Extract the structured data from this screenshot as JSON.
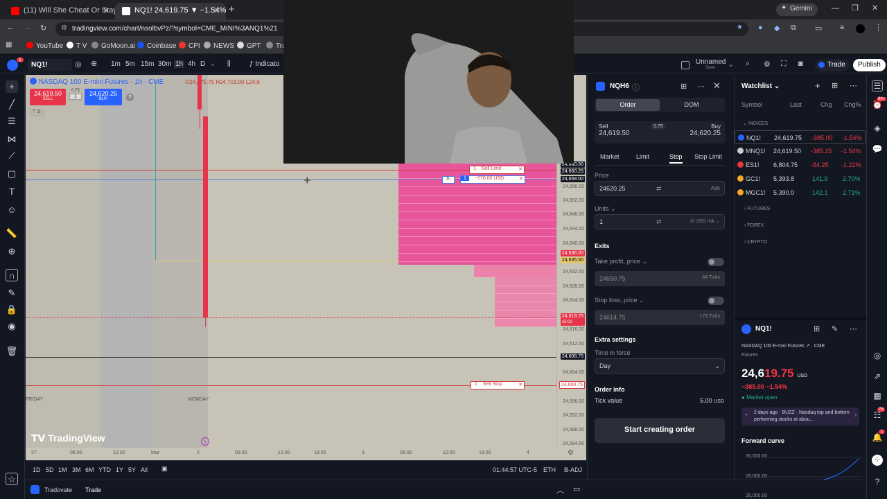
{
  "browser": {
    "tabs": [
      {
        "title": "(11) Will She Cheat Or Stay",
        "active": false
      },
      {
        "title": "NQ1! 24,619.75 ▼ −1.54% Unn",
        "active": true
      }
    ],
    "url": "tradingview.com/chart/nsolbvPz/?symbol=CME_MINI%3ANQ1%21",
    "gemini_label": "Gemini",
    "bookmarks": [
      "YouTube",
      "T V",
      "GoMoon.ai",
      "Coinbase",
      "CPI",
      "NEWS",
      "GPT",
      "Tra"
    ]
  },
  "toolbar": {
    "symbol": "NQ1!",
    "intervals": [
      "1m",
      "5m",
      "15m",
      "30m",
      "1h",
      "4h",
      "D"
    ],
    "active_interval": "1h",
    "indicators_label": "Indicato",
    "layout_name": "Unnamed",
    "layout_sub": "Save",
    "trade_label": "Trade",
    "publish_label": "Publish"
  },
  "chart": {
    "title": "NASDAQ 100 E-mini Futures · 1h · CME",
    "ohlc": "O24,675.75  H24,703.00  L24,6",
    "sell_price": "24,619.50",
    "sell_label": "SELL",
    "spread": "0.75",
    "qty": "1",
    "buy_price": "24,620.25",
    "buy_label": "BUY",
    "indicator_count": "2",
    "sell_limit_label": "Sell Limit",
    "sell_limit_qty": "1",
    "position_qty": "1",
    "position_side": "1L",
    "position_pnl": "−770.00 USD",
    "sell_stop_label": "Sell Stop",
    "sell_stop_qty": "1",
    "day_labels": [
      "FRIDAY",
      "MONDAY"
    ],
    "watermark": "TradingView",
    "price_labels": [
      "24,656.00",
      "24,652.00",
      "24,648.00",
      "24,644.00",
      "24,640.00",
      "24,632.00",
      "24,628.00",
      "24,624.00",
      "24,616.00",
      "24,612.00",
      "24,604.00",
      "24,596.00",
      "24,592.00",
      "24,588.00",
      "24,584.00"
    ],
    "tag_limit_1": "24,660.50",
    "tag_limit_2": "24,660.25",
    "tag_pos": "24,658.00",
    "tag_636": "24,636.00",
    "tag_635": "24,635.50",
    "tag_last": "24,619.75",
    "tag_last_time": "15:02",
    "tag_608": "24,608.75",
    "tag_stop": "24,600.75",
    "time_labels": [
      "27",
      "06:00",
      "12:00",
      "Mar",
      "2",
      "06:00",
      "12:00",
      "18:00",
      "3",
      "06:00",
      "12:00",
      "18:00",
      "4"
    ],
    "ranges": [
      "1D",
      "5D",
      "1M",
      "3M",
      "6M",
      "YTD",
      "1Y",
      "5Y",
      "All"
    ],
    "clock": "01:44:57 UTC-5",
    "session": "ETH",
    "adj": "B-ADJ"
  },
  "status": {
    "broker": "Tradovate",
    "trade_tab": "Trade"
  },
  "order": {
    "symbol": "NQH6",
    "tabs": [
      "Order",
      "DOM"
    ],
    "sell_label": "Sell",
    "sell_price": "24,619.50",
    "spread": "0.75",
    "buy_label": "Buy",
    "buy_price": "24,620.25",
    "types": [
      "Market",
      "Limit",
      "Stop",
      "Stop Limit"
    ],
    "active_type": "Stop",
    "price_label": "Price",
    "price_value": "24620.25",
    "price_side": "Ask",
    "units_label": "Units",
    "units_value": "1",
    "units_mode": "USD risk",
    "exits_label": "Exits",
    "tp_label": "Take profit, price",
    "tp_value": "24650.75",
    "tp_ticks": "64 Ticks",
    "sl_label": "Stop loss, price",
    "sl_value": "24614.75",
    "sl_ticks": "173 Ticks",
    "extra_label": "Extra settings",
    "tif_label": "Time in force",
    "tif_value": "Day",
    "info_label": "Order info",
    "tick_label": "Tick value",
    "tick_value": "5.00",
    "tick_unit": "USD",
    "submit_label": "Start creating order"
  },
  "watchlist": {
    "title": "Watchlist",
    "columns": [
      "Symbol",
      "Last",
      "Chg",
      "Chg%"
    ],
    "group": "INDICES",
    "rows": [
      {
        "symbol": "NQ1!",
        "last": "24,619.75",
        "chg": "-385.00",
        "chgp": "-1.54%",
        "dir": "down",
        "color": "#2962ff"
      },
      {
        "symbol": "MNQ1!",
        "last": "24,619.50",
        "chg": "-385.25",
        "chgp": "-1.54%",
        "dir": "down",
        "color": "#cccccc"
      },
      {
        "symbol": "ES1!",
        "last": "6,804.75",
        "chg": "-84.25",
        "chgp": "-1.22%",
        "dir": "down",
        "color": "#e53935"
      },
      {
        "symbol": "GC1!",
        "last": "5,393.8",
        "chg": "141.9",
        "chgp": "2.70%",
        "dir": "up",
        "color": "#f9a825"
      },
      {
        "symbol": "MGC1!",
        "last": "5,390.0",
        "chg": "142.1",
        "chgp": "2.71%",
        "dir": "up",
        "color": "#f9a825"
      }
    ],
    "collapsed": [
      "FUTURES",
      "FOREX",
      "CRYPTO"
    ],
    "detail_symbol": "NQ1!",
    "detail_name": "NASDAQ 100 E-mini Futures",
    "detail_exchange": "CME",
    "detail_type": "Futures",
    "detail_price_main": "24,6",
    "detail_price_tail": "19.75",
    "detail_currency": "USD",
    "detail_change": "−385.00  −1.54%",
    "market_status": "Market open",
    "news": "2 days ago · BUZZ · Nasdaq top and bottom performing stocks at abou...",
    "curve_label": "Forward curve",
    "curve_ticks": [
      "30,000.00",
      "28,000.00",
      "26,000.00"
    ]
  },
  "badges": {
    "alerts": "99+",
    "notifications": "78",
    "messages": "1",
    "youtube": "1"
  }
}
